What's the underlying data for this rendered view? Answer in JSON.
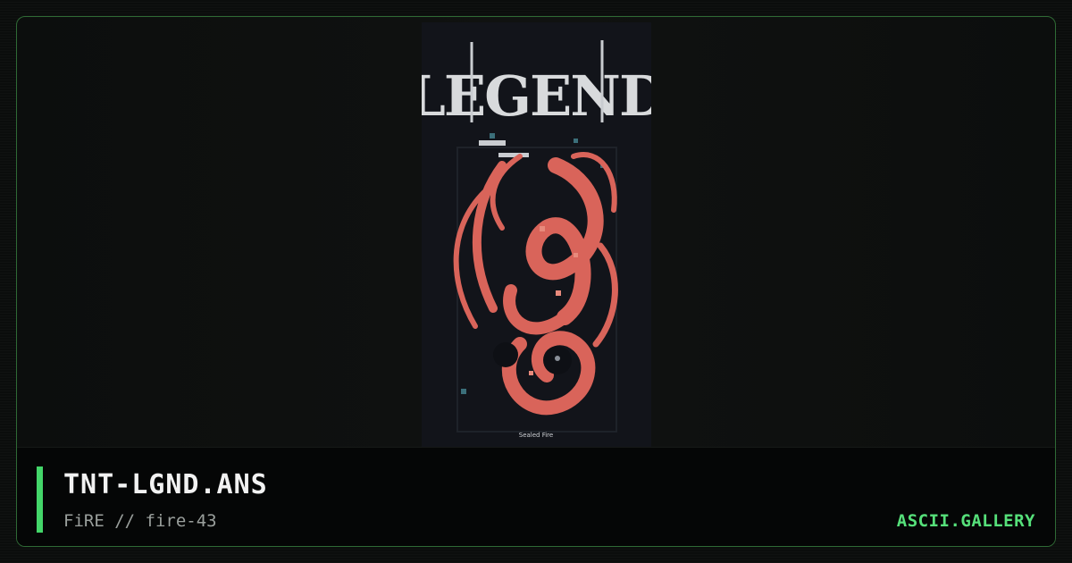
{
  "artwork": {
    "header_text": "LEGEND",
    "caption": "Sealed Fire",
    "icon": "red-dragon-ansi-art"
  },
  "footer": {
    "title": "TNT-LGND.ANS",
    "subtitle": "FiRE // fire-43",
    "brand": "ASCII.GALLERY"
  },
  "colors": {
    "accent": "#43d669",
    "brand": "#56e07a",
    "frame_border": "#2f6a35",
    "dragon": "#d9645a"
  }
}
